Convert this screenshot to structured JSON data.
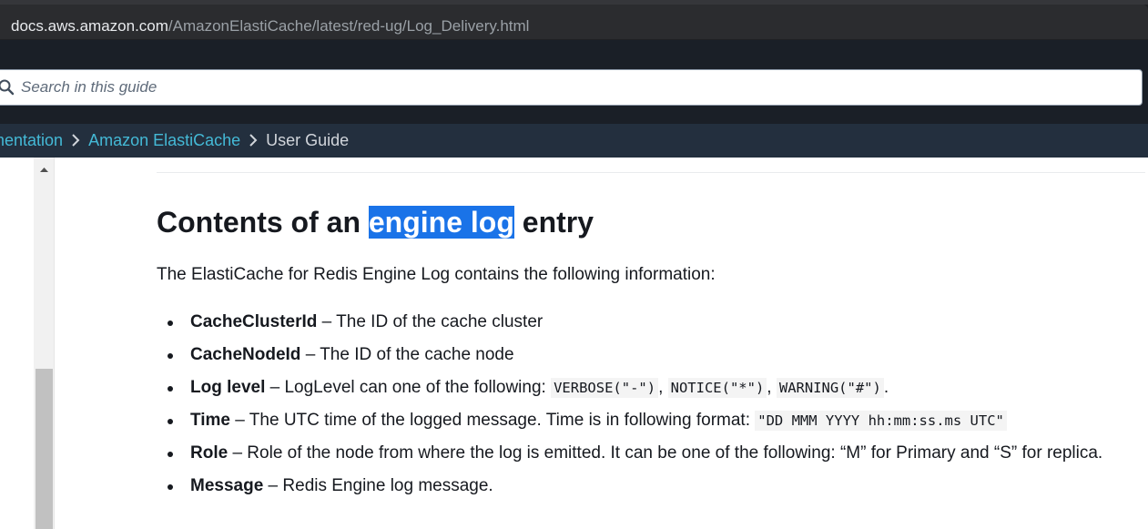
{
  "browser": {
    "url_host": "docs.aws.amazon.com",
    "url_path": "/AmazonElastiCache/latest/red-ug/Log_Delivery.html"
  },
  "search": {
    "placeholder": "Search in this guide",
    "icon": "search-icon"
  },
  "breadcrumb": {
    "items": [
      {
        "label": "mentation",
        "link": true
      },
      {
        "label": "Amazon ElastiCache",
        "link": true
      },
      {
        "label": "User Guide",
        "link": false
      }
    ],
    "separator_icon": "chevron-right-icon"
  },
  "colors": {
    "link": "#44b9d6",
    "highlight": "#1a73e8",
    "header_bg": "#1a1f27",
    "breadcrumb_bg": "#232f3e"
  },
  "content": {
    "heading": {
      "before": "Contents of an ",
      "highlight": "engine log",
      "after": " entry"
    },
    "intro": "The ElastiCache for Redis Engine Log contains the following information:",
    "items": [
      {
        "term": "CacheClusterId",
        "text": " – The ID of the cache cluster"
      },
      {
        "term": "CacheNodeId",
        "text": " – The ID of the cache node"
      },
      {
        "term": "Log level",
        "text": " – LogLevel can one of the following: ",
        "codes": [
          "VERBOSE(\"-\")",
          "NOTICE(\"*\")",
          "WARNING(\"#\")"
        ],
        "sep": ", ",
        "end": "."
      },
      {
        "term": "Time",
        "text": " – The UTC time of the logged message. Time is in following format: ",
        "code": "\"DD MMM YYYY hh:mm:ss.ms UTC\""
      },
      {
        "term": "Role",
        "text": " – Role of the node from where the log is emitted. It can be one of the following: “M” for Primary and “S” for replica."
      },
      {
        "term": "Message",
        "text": " – Redis Engine log message."
      }
    ]
  }
}
